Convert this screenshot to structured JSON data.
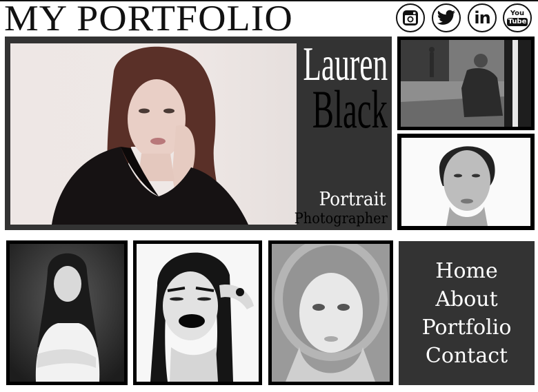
{
  "header": {
    "title": "MY PORTFOLIO",
    "social": [
      {
        "icon": "instagram-icon"
      },
      {
        "icon": "twitter-icon"
      },
      {
        "icon": "linkedin-icon",
        "label": "in"
      },
      {
        "icon": "youtube-icon",
        "label_top": "You",
        "label_bottom": "Tube"
      }
    ]
  },
  "hero": {
    "first_name": "Lauren",
    "last_name": "Black",
    "role_line1": "Portrait",
    "role_line2": "Photographer"
  },
  "nav": {
    "items": [
      "Home",
      "About",
      "Portfolio",
      "Contact"
    ]
  },
  "colors": {
    "panel": "#333333",
    "frame": "#000000",
    "text_light": "#ffffff",
    "text_dark": "#000000"
  }
}
